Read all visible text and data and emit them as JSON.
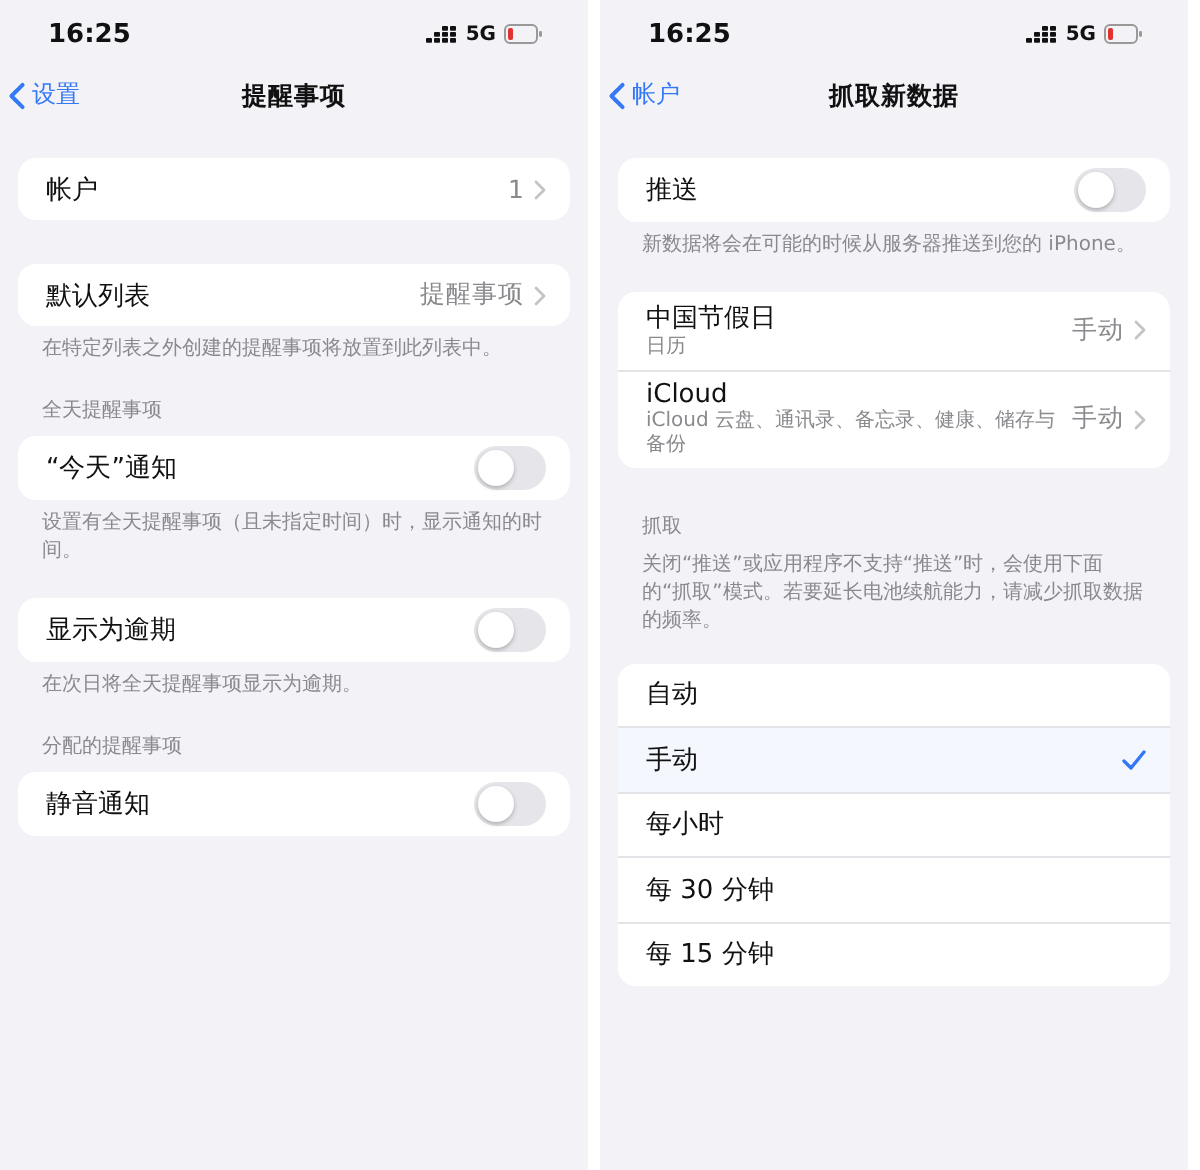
{
  "screens": [
    {
      "status_bar": {
        "time": "16:25",
        "network": "5G"
      },
      "nav": {
        "back": "设置",
        "title": "提醒事项"
      },
      "sections": [
        {
          "rows": [
            {
              "kind": "link",
              "label": "帐户",
              "value": "1"
            }
          ]
        },
        {
          "rows": [
            {
              "kind": "link",
              "label": "默认列表",
              "value": "提醒事项"
            }
          ],
          "footer": "在特定列表之外创建的提醒事项将放置到此列表中。"
        },
        {
          "header": "全天提醒事项",
          "rows": [
            {
              "kind": "toggle",
              "label": "“今天”通知",
              "on": false
            }
          ],
          "footer": "设置有全天提醒事项（且未指定时间）时，显示通知的时间。"
        },
        {
          "rows": [
            {
              "kind": "toggle",
              "label": "显示为逾期",
              "on": false
            }
          ],
          "footer": "在次日将全天提醒事项显示为逾期。"
        },
        {
          "header": "分配的提醒事项",
          "rows": [
            {
              "kind": "toggle",
              "label": "静音通知",
              "on": false
            }
          ]
        }
      ]
    },
    {
      "status_bar": {
        "time": "16:25",
        "network": "5G"
      },
      "nav": {
        "back": "帐户",
        "title": "抓取新数据"
      },
      "sections": [
        {
          "rows": [
            {
              "kind": "toggle",
              "label": "推送",
              "on": false
            }
          ],
          "footer": "新数据将会在可能的时候从服务器推送到您的 iPhone。"
        },
        {
          "rows": [
            {
              "kind": "link",
              "label": "中国节假日",
              "subtitle": "日历",
              "value": "手动"
            },
            {
              "kind": "link",
              "label": "iCloud",
              "subtitle": "iCloud 云盘、通讯录、备忘录、健康、储存与备份",
              "value": "手动"
            }
          ]
        },
        {
          "header": "抓取",
          "footer_top": "关闭“推送”或应用程序不支持“推送”时，会使用下面的“抓取”模式。若要延长电池续航能力，请减少抓取数据的频率。",
          "rows": [
            {
              "kind": "option",
              "label": "自动",
              "selected": false
            },
            {
              "kind": "option",
              "label": "手动",
              "selected": true
            },
            {
              "kind": "option",
              "label": "每小时",
              "selected": false
            },
            {
              "kind": "option",
              "label": "每 30 分钟",
              "selected": false
            },
            {
              "kind": "option",
              "label": "每 15 分钟",
              "selected": false
            }
          ]
        }
      ]
    }
  ]
}
